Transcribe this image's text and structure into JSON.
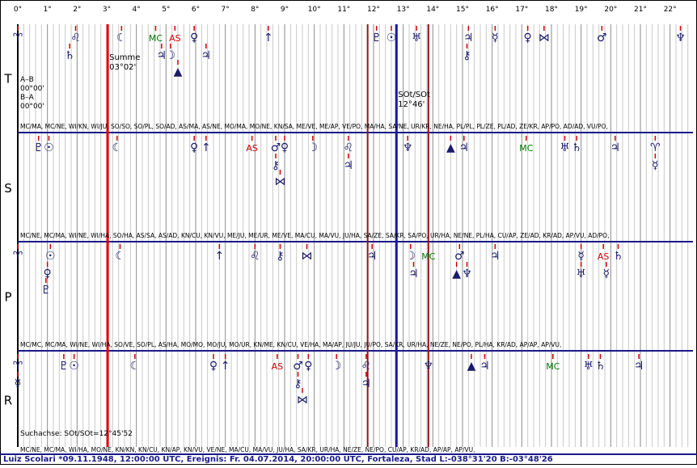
{
  "chart_data": {
    "type": "scatter",
    "x_ticks": [
      "0°",
      "1°",
      "2°",
      "3°",
      "4°",
      "5°",
      "6°",
      "7°",
      "8°",
      "9°",
      "10°",
      "11°",
      "12°",
      "13°",
      "14°",
      "15°",
      "16°",
      "17°",
      "18°",
      "19°",
      "20°",
      "21°",
      "22°"
    ],
    "x_range": [
      0,
      22.5
    ],
    "markers": [
      {
        "name": "Summe",
        "value_label": "03°02'",
        "x": 3.03,
        "color": "#e00000"
      },
      {
        "name": "SOt/SOt",
        "value_label": "12°46'",
        "x": 12.77,
        "color": "#1a1a9a"
      },
      {
        "name": "",
        "value_label": "",
        "x": 11.8,
        "color": "#8a1a1a"
      },
      {
        "name": "",
        "value_label": "",
        "x": 13.85,
        "color": "#8a1a1a"
      }
    ],
    "bands": [
      {
        "label": "T",
        "notes": [
          "A–B",
          "00°00'",
          "B–A",
          "00°00'"
        ],
        "pairs": "MC/MA, MC/NE, WI/KN, WI/JU, SO/SO, SO/PL, SO/AD, AS/MA, AS/NE, MO/MA, MO/NE, KN/SA, ME/VE, ME/AP, VE/PO, MA/HA, SA/NE, UR/KR, NE/HA, PL/PL, PL/ZE, PL/AD, ZE/KR, AP/PO, AD/AD, VU/PO,",
        "points": [
          {
            "g": "♈",
            "x": 0.0,
            "r": 0
          },
          {
            "g": "♌",
            "x": 1.95,
            "r": 0
          },
          {
            "g": "♄",
            "x": 1.75,
            "r": 1
          },
          {
            "g": "☾",
            "x": 3.5,
            "r": 0,
            "s": "moon"
          },
          {
            "g": "MC",
            "x": 4.65,
            "r": 0,
            "c": "#007700"
          },
          {
            "g": "AS",
            "x": 5.3,
            "r": 0,
            "c": "#d00000"
          },
          {
            "g": "♃",
            "x": 4.85,
            "r": 1
          },
          {
            "g": "☽",
            "x": 5.15,
            "r": 1
          },
          {
            "g": "♀",
            "x": 5.95,
            "r": 0
          },
          {
            "g": "♃",
            "x": 6.35,
            "r": 1
          },
          {
            "g": "▲",
            "x": 5.4,
            "r": 2
          },
          {
            "g": "↑",
            "x": 8.45,
            "r": 0
          },
          {
            "g": "♇",
            "x": 12.1,
            "r": 0
          },
          {
            "g": "☉",
            "x": 12.6,
            "r": 0
          },
          {
            "g": "♅",
            "x": 13.45,
            "r": 0
          },
          {
            "g": "♃",
            "x": 15.2,
            "r": 0
          },
          {
            "g": "⚷",
            "x": 15.15,
            "r": 1
          },
          {
            "g": "☿",
            "x": 16.1,
            "r": 0
          },
          {
            "g": "♀",
            "x": 17.2,
            "r": 0
          },
          {
            "g": "⋈",
            "x": 17.75,
            "r": 0
          },
          {
            "g": "♂",
            "x": 19.7,
            "r": 0
          },
          {
            "g": "♆",
            "x": 22.35,
            "r": 0
          }
        ]
      },
      {
        "label": "S",
        "notes": [],
        "pairs": "MC/NE, MC/MA, WI/NE, WI/HA, SO/HA, AS/SA, AS/AD, KN/CU, KN/VU, ME/JU, ME/UR, ME/VE, MA/CU, MA/VU, JU/HA, SA/ZE, SA/KR, SA/PO, UR/HA, NE/NE, PL/HA, CU/AP, ZE/AD, KR/AD, AP/VU, AD/PO,",
        "points": [
          {
            "g": "♇",
            "x": 0.7,
            "r": 0
          },
          {
            "g": "☉",
            "x": 1.05,
            "r": 0
          },
          {
            "g": "☾",
            "x": 3.35,
            "r": 0,
            "s": "moon"
          },
          {
            "g": "♀",
            "x": 5.95,
            "r": 0
          },
          {
            "g": "↑",
            "x": 6.35,
            "r": 0
          },
          {
            "g": "AS",
            "x": 7.9,
            "r": 0,
            "c": "#d00000"
          },
          {
            "g": "♂",
            "x": 8.7,
            "r": 0
          },
          {
            "g": "♀",
            "x": 9.0,
            "r": 0
          },
          {
            "g": "⚷",
            "x": 8.7,
            "r": 1
          },
          {
            "g": "⋈",
            "x": 8.85,
            "r": 2
          },
          {
            "g": "☽",
            "x": 9.95,
            "r": 0
          },
          {
            "g": "♌",
            "x": 11.15,
            "r": 0
          },
          {
            "g": "♃",
            "x": 11.15,
            "r": 1
          },
          {
            "g": "♆",
            "x": 13.15,
            "r": 0
          },
          {
            "g": "▲",
            "x": 14.6,
            "r": 0
          },
          {
            "g": "♃",
            "x": 15.05,
            "r": 0
          },
          {
            "g": "MC",
            "x": 17.15,
            "r": 0,
            "c": "#007700"
          },
          {
            "g": "♅",
            "x": 18.45,
            "r": 0
          },
          {
            "g": "♄",
            "x": 18.85,
            "r": 0
          },
          {
            "g": "♃",
            "x": 20.15,
            "r": 0
          },
          {
            "g": "♈",
            "x": 21.5,
            "r": 0
          },
          {
            "g": "☿",
            "x": 21.5,
            "r": 1
          }
        ]
      },
      {
        "label": "P",
        "notes": [],
        "pairs": "MC/MC, MC/MA, WI/NE, WI/HA, SO/VE, SO/PL, AS/HA, MO/MO, MO/JU, MO/UR, KN/ME, KN/CU, VE/HA, MA/AP, JU/JU, JU/PO, SA/KR, UR/HA, NE/ZE, NE/PO, PL/HA, KR/AD, AP/AP, AP/VU,",
        "points": [
          {
            "g": "♈",
            "x": 0.0,
            "r": 0
          },
          {
            "g": "☉",
            "x": 1.1,
            "r": 0
          },
          {
            "g": "♀",
            "x": 1.0,
            "r": 1
          },
          {
            "g": "♇",
            "x": 0.95,
            "r": 2
          },
          {
            "g": "☾",
            "x": 3.45,
            "r": 0,
            "s": "moon"
          },
          {
            "g": "↑",
            "x": 6.8,
            "r": 0
          },
          {
            "g": "♌",
            "x": 8.0,
            "r": 0
          },
          {
            "g": "⚷",
            "x": 8.85,
            "r": 0
          },
          {
            "g": "⋈",
            "x": 9.75,
            "r": 0
          },
          {
            "g": "♃",
            "x": 11.95,
            "r": 0
          },
          {
            "g": "☽",
            "x": 13.25,
            "r": 0
          },
          {
            "g": "MC",
            "x": 13.85,
            "r": 0,
            "c": "#007700"
          },
          {
            "g": "♃",
            "x": 13.35,
            "r": 1
          },
          {
            "g": "♂",
            "x": 14.9,
            "r": 0
          },
          {
            "g": "▲",
            "x": 14.8,
            "r": 1
          },
          {
            "g": "♆",
            "x": 15.15,
            "r": 1
          },
          {
            "g": "♃",
            "x": 16.1,
            "r": 0
          },
          {
            "g": "☿",
            "x": 19.0,
            "r": 0
          },
          {
            "g": "♅",
            "x": 19.0,
            "r": 1
          },
          {
            "g": "AS",
            "x": 19.75,
            "r": 0,
            "c": "#d00000"
          },
          {
            "g": "♄",
            "x": 20.25,
            "r": 0
          },
          {
            "g": "☿",
            "x": 19.85,
            "r": 1
          }
        ]
      },
      {
        "label": "R",
        "notes": [
          "Suchachse: SOt/SOt=12°45'52"
        ],
        "pairs": "MC/NE, MC/MA, WI/HA, MO/NE, KN/KN, KN/CU, KN/AP, KN/VU, VE/NE, MA/CU, MA/VU, JU/HA, SA/KR, UR/HA, NE/ZE, NE/PO, CU/AP, KR/AD, AP/AP, AP/VU,",
        "points": [
          {
            "g": "♈",
            "x": 0.0,
            "r": 0
          },
          {
            "g": "☿",
            "x": 0.0,
            "r": 1
          },
          {
            "g": "♇",
            "x": 1.55,
            "r": 0
          },
          {
            "g": "☉",
            "x": 1.9,
            "r": 0
          },
          {
            "g": "☾",
            "x": 3.95,
            "r": 0,
            "s": "moon"
          },
          {
            "g": "♀",
            "x": 6.6,
            "r": 0
          },
          {
            "g": "↑",
            "x": 7.0,
            "r": 0
          },
          {
            "g": "AS",
            "x": 8.75,
            "r": 0,
            "c": "#d00000"
          },
          {
            "g": "♂",
            "x": 9.45,
            "r": 0
          },
          {
            "g": "♀",
            "x": 9.8,
            "r": 0
          },
          {
            "g": "⚷",
            "x": 9.45,
            "r": 1
          },
          {
            "g": "⋈",
            "x": 9.6,
            "r": 2
          },
          {
            "g": "☽",
            "x": 10.75,
            "r": 0
          },
          {
            "g": "♌",
            "x": 11.75,
            "r": 0
          },
          {
            "g": "♃",
            "x": 11.75,
            "r": 1
          },
          {
            "g": "♆",
            "x": 13.85,
            "r": 0
          },
          {
            "g": "▲",
            "x": 15.3,
            "r": 0
          },
          {
            "g": "♃",
            "x": 15.75,
            "r": 0
          },
          {
            "g": "MC",
            "x": 18.05,
            "r": 0,
            "c": "#007700"
          },
          {
            "g": "♅",
            "x": 19.25,
            "r": 0
          },
          {
            "g": "♄",
            "x": 19.65,
            "r": 0
          },
          {
            "g": "♃",
            "x": 20.95,
            "r": 0
          }
        ]
      }
    ]
  },
  "footer": "Luiz Scolari   *09.11.1948, 12:00:00 UTC, Ereignis: Fr. 04.07.2014, 20:00:00 UTC, Fortaleza, Stad L:-038°31'20 B:-03°48'26"
}
